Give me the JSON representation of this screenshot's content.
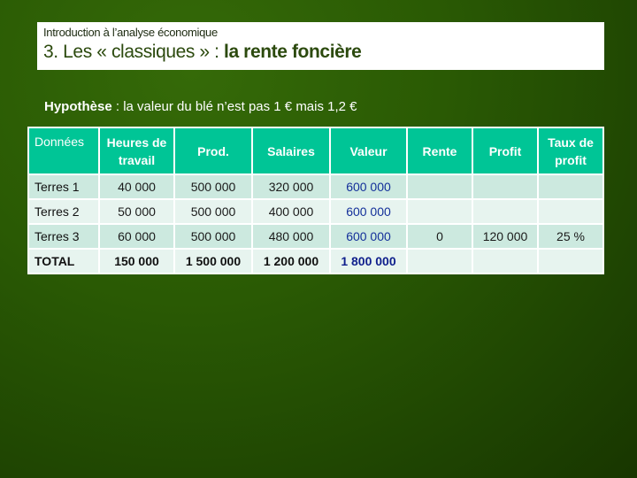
{
  "header": {
    "subtitle": "Introduction à l’analyse économique",
    "title_prefix": "3. Les « classiques » : ",
    "title_bold": "la rente foncière"
  },
  "hypothesis": {
    "label": "Hypothèse",
    "text": " : la valeur du blé n’est pas 1 € mais 1,2 €"
  },
  "table": {
    "headers": [
      "Données",
      "Heures de travail",
      "Prod.",
      "Salaires",
      "Valeur",
      "Rente",
      "Profit",
      "Taux de profit"
    ],
    "rows": [
      [
        "Terres 1",
        "40 000",
        "500 000",
        "320 000",
        "600 000",
        "",
        "",
        ""
      ],
      [
        "Terres 2",
        "50 000",
        "500 000",
        "400 000",
        "600 000",
        "",
        "",
        ""
      ],
      [
        "Terres 3",
        "60 000",
        "500 000",
        "480 000",
        "600 000",
        "0",
        "120 000",
        "25 %"
      ],
      [
        "TOTAL",
        "150 000",
        "1 500 000",
        "1 200 000",
        "1 800 000",
        "",
        "",
        ""
      ]
    ]
  },
  "colors": {
    "header_bg": "#00c596",
    "value_text": "#14309a",
    "background": "#2a5a04"
  }
}
